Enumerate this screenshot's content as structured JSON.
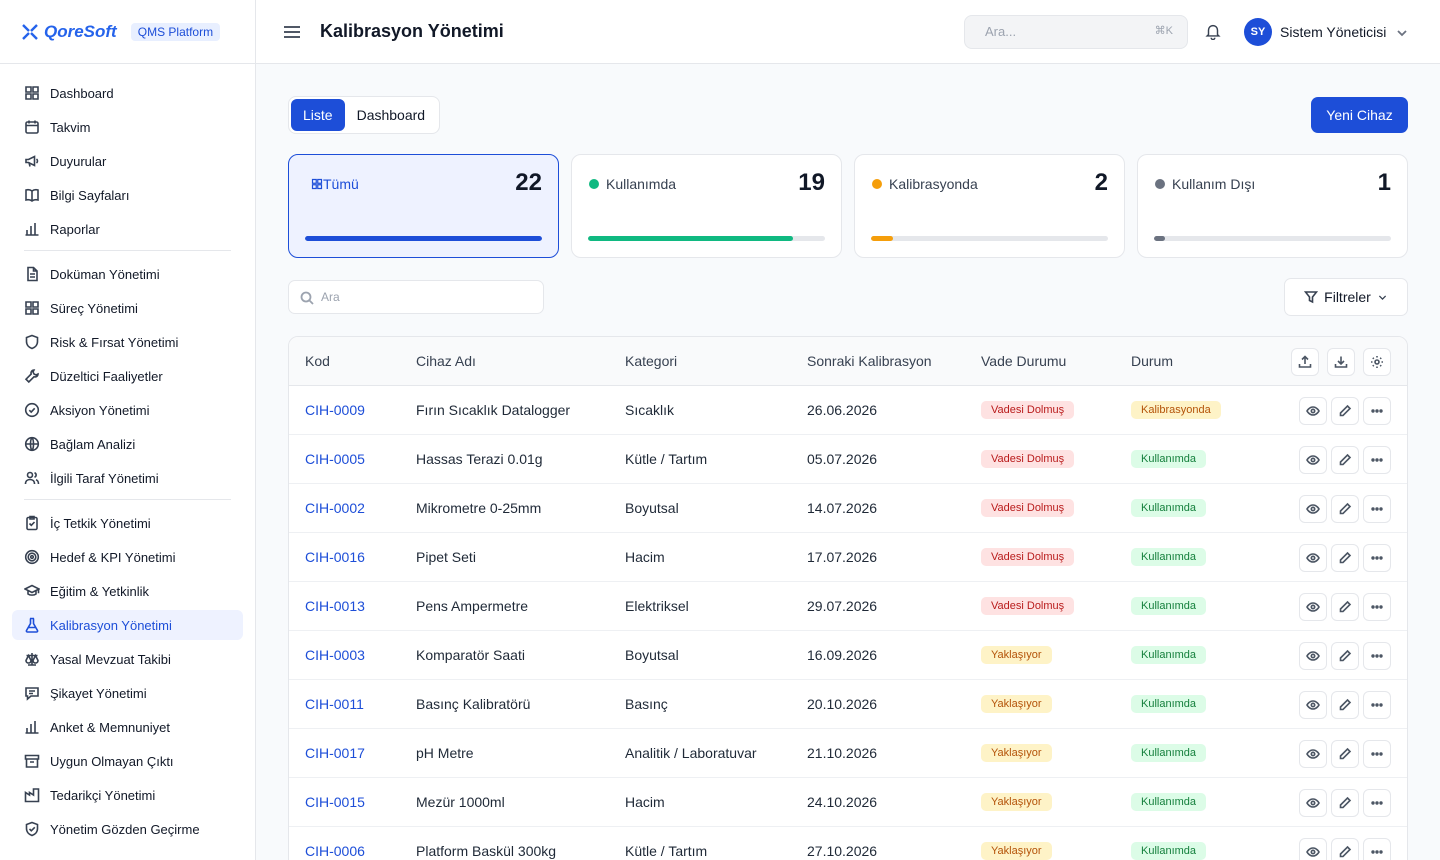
{
  "brand": {
    "name": "QoreSoft",
    "badge": "QMS Platform"
  },
  "sidebar": {
    "groups": [
      [
        {
          "label": "Dashboard",
          "icon": "grid-icon"
        },
        {
          "label": "Takvim",
          "icon": "calendar-icon"
        },
        {
          "label": "Duyurular",
          "icon": "megaphone-icon"
        },
        {
          "label": "Bilgi Sayfaları",
          "icon": "book-icon"
        },
        {
          "label": "Raporlar",
          "icon": "bar-chart-icon"
        }
      ],
      [
        {
          "label": "Doküman Yönetimi",
          "icon": "document-icon"
        },
        {
          "label": "Süreç Yönetimi",
          "icon": "grid-icon"
        },
        {
          "label": "Risk & Fırsat Yönetimi",
          "icon": "shield-icon"
        },
        {
          "label": "Düzeltici Faaliyetler",
          "icon": "wrench-icon"
        },
        {
          "label": "Aksiyon Yönetimi",
          "icon": "check-circle-icon"
        },
        {
          "label": "Bağlam Analizi",
          "icon": "globe-icon"
        },
        {
          "label": "İlgili Taraf Yönetimi",
          "icon": "users-icon"
        }
      ],
      [
        {
          "label": "İç Tetkik Yönetimi",
          "icon": "clipboard-icon"
        },
        {
          "label": "Hedef & KPI Yönetimi",
          "icon": "target-icon"
        },
        {
          "label": "Eğitim & Yetkinlik",
          "icon": "graduation-icon"
        },
        {
          "label": "Kalibrasyon Yönetimi",
          "icon": "flask-icon",
          "active": true
        },
        {
          "label": "Yasal Mevzuat Takibi",
          "icon": "scale-icon"
        },
        {
          "label": "Şikayet Yönetimi",
          "icon": "message-icon"
        },
        {
          "label": "Anket & Memnuniyet",
          "icon": "bar-chart-icon"
        },
        {
          "label": "Uygun Olmayan Çıktı",
          "icon": "archive-icon"
        },
        {
          "label": "Tedarikçi Yönetimi",
          "icon": "factory-icon"
        },
        {
          "label": "Yönetim Gözden Geçirme",
          "icon": "shield-check-icon"
        }
      ]
    ]
  },
  "header": {
    "title": "Kalibrasyon Yönetimi",
    "search_placeholder": "Ara...",
    "shortcut": "⌘K",
    "user": {
      "initials": "SY",
      "name": "Sistem Yöneticisi"
    }
  },
  "toolbar": {
    "tabs": [
      "Liste",
      "Dashboard"
    ],
    "active_tab": 0,
    "new_button": "Yeni Cihaz"
  },
  "stats": [
    {
      "label": "Tümü",
      "count": "22",
      "fraction": 1.0,
      "color": "#1d4ed8",
      "active": true
    },
    {
      "label": "Kullanımda",
      "count": "19",
      "fraction": 0.864,
      "color": "#10b981"
    },
    {
      "label": "Kalibrasyonda",
      "count": "2",
      "fraction": 0.091,
      "color": "#f59e0b"
    },
    {
      "label": "Kullanım Dışı",
      "count": "1",
      "fraction": 0.045,
      "color": "#6b7280"
    }
  ],
  "filters": {
    "search_placeholder": "Ara",
    "filter_label": "Filtreler"
  },
  "table": {
    "columns": [
      "Kod",
      "Cihaz Adı",
      "Kategori",
      "Sonraki Kalibrasyon",
      "Vade Durumu",
      "Durum"
    ],
    "rows": [
      {
        "code": "CIH-0009",
        "name": "Fırın Sıcaklık Datalogger",
        "category": "Sıcaklık",
        "next": "26.06.2026",
        "due": "Vadesi Dolmuş",
        "due_tone": "red",
        "status": "Kalibrasyonda",
        "status_tone": "cal"
      },
      {
        "code": "CIH-0005",
        "name": "Hassas Terazi 0.01g",
        "category": "Kütle / Tartım",
        "next": "05.07.2026",
        "due": "Vadesi Dolmuş",
        "due_tone": "red",
        "status": "Kullanımda",
        "status_tone": "green"
      },
      {
        "code": "CIH-0002",
        "name": "Mikrometre 0-25mm",
        "category": "Boyutsal",
        "next": "14.07.2026",
        "due": "Vadesi Dolmuş",
        "due_tone": "red",
        "status": "Kullanımda",
        "status_tone": "green"
      },
      {
        "code": "CIH-0016",
        "name": "Pipet Seti",
        "category": "Hacim",
        "next": "17.07.2026",
        "due": "Vadesi Dolmuş",
        "due_tone": "red",
        "status": "Kullanımda",
        "status_tone": "green"
      },
      {
        "code": "CIH-0013",
        "name": "Pens Ampermetre",
        "category": "Elektriksel",
        "next": "29.07.2026",
        "due": "Vadesi Dolmuş",
        "due_tone": "red",
        "status": "Kullanımda",
        "status_tone": "green"
      },
      {
        "code": "CIH-0003",
        "name": "Komparatör Saati",
        "category": "Boyutsal",
        "next": "16.09.2026",
        "due": "Yaklaşıyor",
        "due_tone": "amber",
        "status": "Kullanımda",
        "status_tone": "green"
      },
      {
        "code": "CIH-0011",
        "name": "Basınç Kalibratörü",
        "category": "Basınç",
        "next": "20.10.2026",
        "due": "Yaklaşıyor",
        "due_tone": "amber",
        "status": "Kullanımda",
        "status_tone": "green"
      },
      {
        "code": "CIH-0017",
        "name": "pH Metre",
        "category": "Analitik / Laboratuvar",
        "next": "21.10.2026",
        "due": "Yaklaşıyor",
        "due_tone": "amber",
        "status": "Kullanımda",
        "status_tone": "green"
      },
      {
        "code": "CIH-0015",
        "name": "Mezür 1000ml",
        "category": "Hacim",
        "next": "24.10.2026",
        "due": "Yaklaşıyor",
        "due_tone": "amber",
        "status": "Kullanımda",
        "status_tone": "green"
      },
      {
        "code": "CIH-0006",
        "name": "Platform Baskül 300kg",
        "category": "Kütle / Tartım",
        "next": "27.10.2026",
        "due": "Yaklaşıyor",
        "due_tone": "amber",
        "status": "Kullanımda",
        "status_tone": "green"
      }
    ]
  }
}
